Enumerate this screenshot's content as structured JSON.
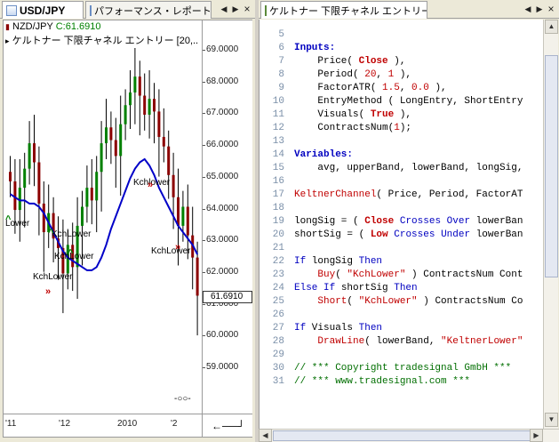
{
  "left_tabs": {
    "tab1_label": "USD/JPY",
    "tab2_label": "パフォーマンス・レポート［",
    "prev": "◀",
    "next": "▶",
    "close": "×"
  },
  "chart": {
    "symbol_label": "NZD/JPY",
    "close_label": "C:61.6910",
    "indicator_label": "ケルトナー 下限チャネル エントリー [20,...",
    "price_tag": "61.6910",
    "y_ticks": [
      "69.0000",
      "68.0000",
      "67.0000",
      "66.0000",
      "65.0000",
      "64.0000",
      "63.0000",
      "62.0000",
      "61.0000",
      "60.0000",
      "59.0000"
    ],
    "x_ticks": [
      "'11",
      "'12",
      "2010",
      "'2"
    ],
    "annotations": [
      "Lower",
      "KchLower",
      "KchLower",
      "Kchlower",
      "KchLower",
      "KchLower"
    ],
    "colors": {
      "up": "#008000",
      "down": "#8b0000",
      "band": "#0000c8",
      "signal": "#c00000"
    }
  },
  "chart_data": {
    "type": "candlestick",
    "title": "",
    "xlabel": "",
    "ylabel": "",
    "ylim": [
      58.6,
      69.8
    ],
    "x_ticks": [
      "'11",
      "'12",
      "2010",
      "'2"
    ],
    "close": [
      64.8,
      63.9,
      64.6,
      65.2,
      66.0,
      65.4,
      64.1,
      63.2,
      63.8,
      63.0,
      62.7,
      61.9,
      62.8,
      62.1,
      63.4,
      64.0,
      64.6,
      64.2,
      65.1,
      66.0,
      66.5,
      66.1,
      65.6,
      66.6,
      67.2,
      67.6,
      68.1,
      67.5,
      66.9,
      67.4,
      67.0,
      66.2,
      65.9,
      65.0,
      64.3,
      63.4,
      64.0,
      63.1,
      62.4,
      61.2
    ],
    "band_lower": [
      64.4,
      64.3,
      64.2,
      64.2,
      64.1,
      64.1,
      64.0,
      63.8,
      63.5,
      63.2,
      62.9,
      62.6,
      62.4,
      62.3,
      62.2,
      62.1,
      62.0,
      62.0,
      62.1,
      62.4,
      62.8,
      63.3,
      63.7,
      64.1,
      64.5,
      64.9,
      65.2,
      65.4,
      65.5,
      65.3,
      65.0,
      64.6,
      64.3,
      64.0,
      63.7,
      63.4,
      63.2,
      63.0,
      62.8,
      62.5
    ]
  },
  "right_tabs": {
    "tab_label": "ケルトナー 下限チャネル エントリー",
    "prev": "◀",
    "next": "▶",
    "close": "×"
  },
  "editor": {
    "line_numbers": [
      "5",
      "6",
      "7",
      "8",
      "9",
      "10",
      "11",
      "12",
      "13",
      "14",
      "15",
      "16",
      "17",
      "18",
      "19",
      "20",
      "21",
      "22",
      "23",
      "24",
      "25",
      "26",
      "27",
      "28",
      "29",
      "30",
      "31"
    ],
    "lines": [
      "",
      "Inputs:",
      "    Price( Close ),",
      "    Period( 20, 1 ),",
      "    FactorATR( 1.5, 0.0 ),",
      "    EntryMethod ( LongEntry, ShortEntry",
      "    Visuals( True ),",
      "    ContractsNum(1);",
      "",
      "Variables:",
      "    avg, upperBand, lowerBand, longSig,",
      "",
      "KeltnerChannel( Price, Period, FactorAT",
      "",
      "longSig = ( Close Crosses Over lowerBan",
      "shortSig = ( Low Crosses Under lowerBan",
      "",
      "If longSig Then",
      "    Buy( \"KchLower\" ) ContractsNum Cont",
      "Else If shortSig Then",
      "    Short( \"KchLower\" ) ContractsNum Co",
      "",
      "If Visuals Then",
      "    DrawLine( lowerBand, \"KeltnerLower\"",
      "",
      "// *** Copyright tradesignal GmbH ***",
      "// *** www.tradesignal.com ***"
    ]
  }
}
